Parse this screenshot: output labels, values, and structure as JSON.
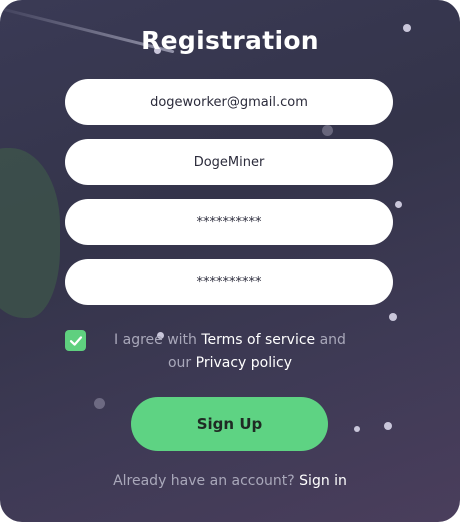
{
  "title": "Registration",
  "fields": {
    "email": "dogeworker@gmail.com",
    "username": "DogeMiner",
    "password": "**********",
    "confirm_password": "**********"
  },
  "agreement": {
    "checked": true,
    "prefix": "I agree with ",
    "terms_link": "Terms of service",
    "middle": " and",
    "our": "our ",
    "privacy_link": "Privacy policy"
  },
  "signup_label": "Sign Up",
  "footer": {
    "prompt": "Already have an account? ",
    "signin_link": "Sign in"
  },
  "colors": {
    "accent": "#5ed383",
    "background": "#34344a"
  }
}
